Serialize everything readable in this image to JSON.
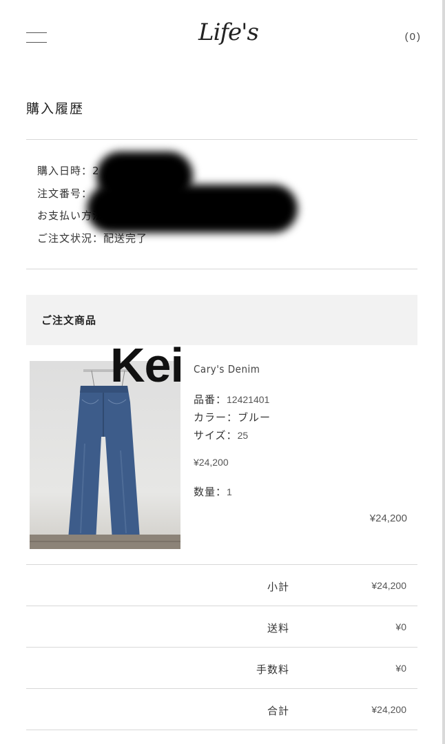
{
  "header": {
    "logo": "Life's",
    "cart_count": "(0)"
  },
  "page_title": "購入履歴",
  "order_info": {
    "date_label": "購入日時：",
    "date_value": "2",
    "number_label": "注文番号：",
    "payment_label": "お支払い方法：",
    "status_label": "ご注文状況：",
    "status_value": "配送完了"
  },
  "items_section_title": "ご注文商品",
  "watermark_text": "Kei",
  "product": {
    "name": "Cary's Denim",
    "sku_label": "品番：",
    "sku_value": "12421401",
    "color_label": "カラー：",
    "color_value": "ブルー",
    "size_label": "サイズ：",
    "size_value": "25",
    "unit_price": "¥24,200",
    "quantity_label": "数量：",
    "quantity_value": "1",
    "line_total": "¥24,200"
  },
  "summary": [
    {
      "label": "小計",
      "amount": "¥24,200"
    },
    {
      "label": "送料",
      "amount": "¥0"
    },
    {
      "label": "手数料",
      "amount": "¥0"
    },
    {
      "label": "合計",
      "amount": "¥24,200"
    }
  ],
  "colors": {
    "rule": "#d8d8d8",
    "section_bg": "#f2f2f2",
    "denim": "#3d5c8a"
  }
}
